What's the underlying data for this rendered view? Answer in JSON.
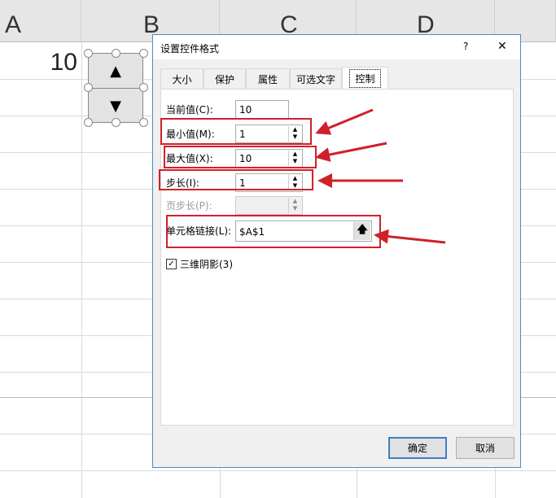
{
  "sheet": {
    "columns": [
      "A",
      "B",
      "C",
      "D"
    ],
    "cell_a1": "10"
  },
  "dialog": {
    "title": "设置控件格式",
    "help": "?",
    "close": "✕",
    "tabs": [
      "大小",
      "保护",
      "属性",
      "可选文字",
      "控制"
    ],
    "fields": {
      "current": {
        "label": "当前值(C):",
        "value": "10"
      },
      "min": {
        "label": "最小值(M):",
        "value": "1"
      },
      "max": {
        "label": "最大值(X):",
        "value": "10"
      },
      "step": {
        "label": "步长(I):",
        "value": "1"
      },
      "page": {
        "label": "页步长(P):",
        "value": ""
      },
      "link": {
        "label": "单元格链接(L):",
        "value": "$A$1"
      }
    },
    "checkbox": {
      "label": "三维阴影(3)",
      "checked": true
    },
    "ok": "确定",
    "cancel": "取消"
  },
  "annotation_color": "#d0202a"
}
